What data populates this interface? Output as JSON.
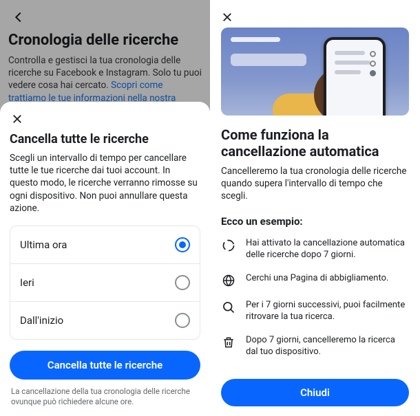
{
  "left": {
    "bg_title": "Cronologia delle ricerche",
    "bg_desc_1": "Controlla e gestisci la tua cronologia delle ricerche su Facebook e Instagram. Solo tu puoi vedere cosa hai cercato. ",
    "bg_link": "Scopri come trattiamo le tue informazioni nella nostra",
    "sheet_title": "Cancella tutte le ricerche",
    "sheet_desc": "Scegli un intervallo di tempo per cancellare tutte le tue ricerche dai tuoi account. In questo modo, le ricerche verranno rimosse su ogni dispositivo. Non puoi annullare questa azione.",
    "options": [
      {
        "label": "Ultima ora",
        "selected": true
      },
      {
        "label": "Ieri",
        "selected": false
      },
      {
        "label": "Dall'inizio",
        "selected": false
      }
    ],
    "button": "Cancella tutte le ricerche",
    "footnote": "La cancellazione della tua cronologia delle ricerche ovunque può richiedere alcune ore."
  },
  "right": {
    "title": "Come funziona la cancellazione automatica",
    "desc": "Cancelleremo la tua cronologia delle ricerche quando supera l'intervallo di tempo che scegli.",
    "subtitle": "Ecco un esempio:",
    "steps": [
      {
        "icon": "spinner",
        "text": "Hai attivato la cancellazione automatica delle ricerche dopo 7 giorni."
      },
      {
        "icon": "globe",
        "text": "Cerchi una Pagina di abbigliamento."
      },
      {
        "icon": "search",
        "text": "Per i 7 giorni successivi, puoi facilmente ritrovare la tua ricerca."
      },
      {
        "icon": "trash",
        "text": "Dopo 7 giorni, cancelleremo la ricerca dal tuo dispositivo."
      }
    ],
    "close": "Chiudi"
  }
}
